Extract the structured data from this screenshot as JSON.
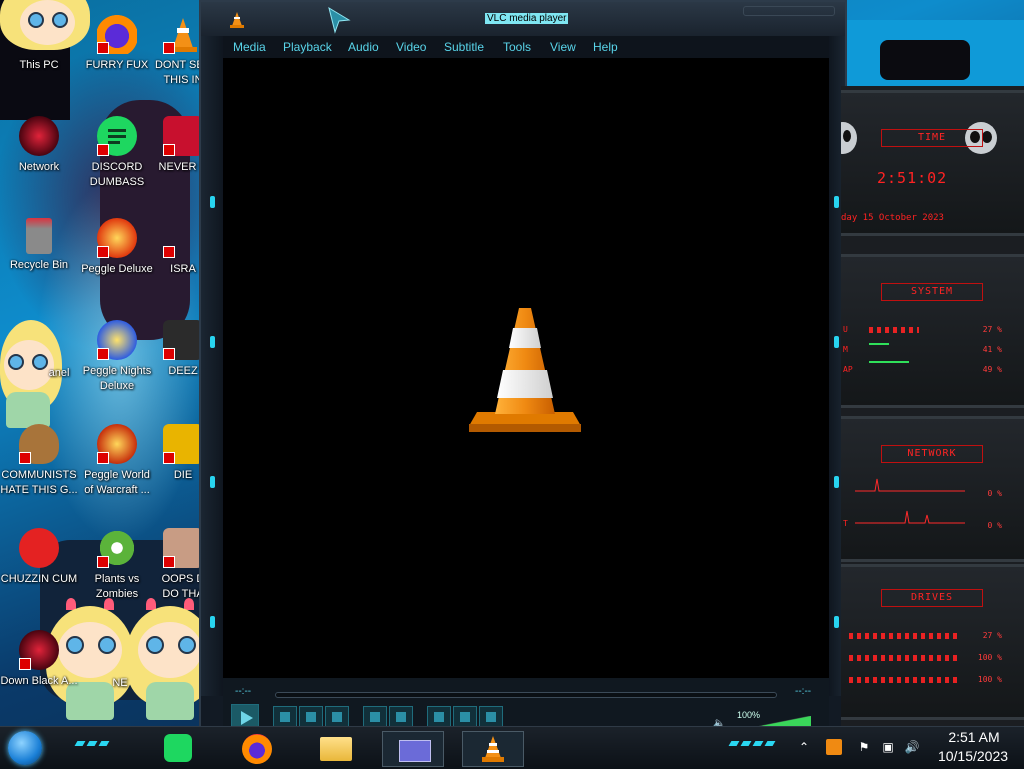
{
  "desktop": {
    "icons": [
      {
        "label": "This PC",
        "icon": "this-pc-icon"
      },
      {
        "label": "FURRY FUX",
        "icon": "firefox-icon"
      },
      {
        "label": "DONT SEE THIS IN",
        "icon": "vlc-cone-icon"
      },
      {
        "label": "Network",
        "icon": "network-icon"
      },
      {
        "label": "DISCORD DUMBASS",
        "icon": "spotify-like-green-icon"
      },
      {
        "label": "NEVER U",
        "icon": "devcpp-icon"
      },
      {
        "label": "Recycle Bin",
        "icon": "recycle-bin-icon"
      },
      {
        "label": "Peggle Deluxe",
        "icon": "peggle-icon"
      },
      {
        "label": "ISRA",
        "icon": "app-icon"
      },
      {
        "label": "anel",
        "icon": "control-panel-icon"
      },
      {
        "label": "Peggle Nights Deluxe",
        "icon": "peggle-nights-icon"
      },
      {
        "label": "DEEZ",
        "icon": "app-icon"
      },
      {
        "label": "COMMUNISTS HATE THIS G...",
        "icon": "money-bag-icon"
      },
      {
        "label": "Peggle World of Warcraft ...",
        "icon": "peggle-wow-icon"
      },
      {
        "label": "DIE",
        "icon": "app-icon"
      },
      {
        "label": "CHUZZIN CUM",
        "icon": "chuzzle-icon"
      },
      {
        "label": "Plants vs Zombies",
        "icon": "pvz-icon"
      },
      {
        "label": "OOPS D DO THA",
        "icon": "photo-icon"
      },
      {
        "label": "Down Black A...",
        "icon": "app-icon"
      },
      {
        "label": "NE",
        "icon": "app-icon"
      }
    ]
  },
  "vlc": {
    "title": "VLC media player",
    "menu": [
      "Media",
      "Playback",
      "Audio",
      "Video",
      "Subtitle",
      "Tools",
      "View",
      "Help"
    ],
    "time_elapsed": "--:--",
    "time_total": "--:--",
    "volume": "100%",
    "volume_level": 1.0
  },
  "gadgets": {
    "time": {
      "header": "TIME",
      "clock": "2:51:02",
      "date": "day 15 October 2023"
    },
    "system": {
      "header": "SYSTEM",
      "rows": [
        {
          "label": "U",
          "value": "27 %"
        },
        {
          "label": "M",
          "value": "41 %"
        },
        {
          "label": "AP",
          "value": "49 %"
        }
      ]
    },
    "network": {
      "header": "NETWORK",
      "rows": [
        {
          "label": "",
          "value": "0 %"
        },
        {
          "label": "T",
          "value": "0 %"
        }
      ]
    },
    "drives": {
      "header": "DRIVES",
      "rows": [
        {
          "label": "",
          "value": "27 %"
        },
        {
          "label": "",
          "value": "100 %"
        },
        {
          "label": "",
          "value": "100 %"
        }
      ]
    }
  },
  "taskbar": {
    "apps": [
      "spotify-like-green-icon",
      "firefox-icon",
      "file-explorer-icon",
      "window-switcher-icon",
      "vlc-cone-icon"
    ],
    "tray_icons": [
      "chevron-up-icon",
      "vlc-tray-icon",
      "flag-icon",
      "network-tray-icon",
      "speaker-icon"
    ],
    "clock_time": "2:51 AM",
    "clock_date": "10/15/2023"
  },
  "colors": {
    "accent_cyan": "#28d4f0",
    "vlc_orange": "#f08a12",
    "gadget_red": "#ff2424"
  }
}
